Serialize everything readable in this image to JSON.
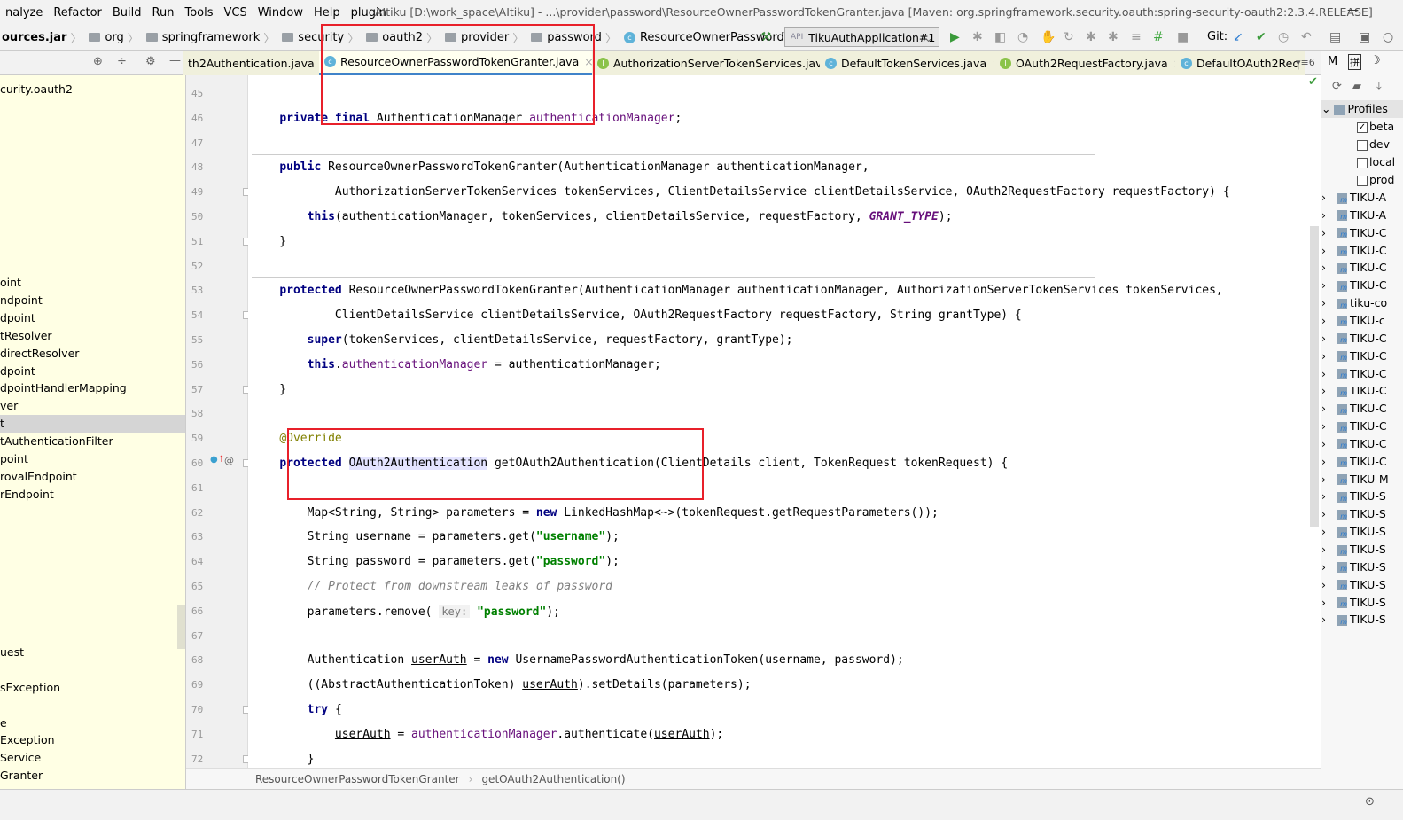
{
  "menu": [
    "nalyze",
    "Refactor",
    "Build",
    "Run",
    "Tools",
    "VCS",
    "Window",
    "Help",
    "plugin"
  ],
  "window_title": "AItiku [D:\\work_space\\AItiku] - ...\\provider\\password\\ResourceOwnerPasswordTokenGranter.java [Maven: org.springframework.security.oauth:spring-security-oauth2:2.3.4.RELEASE]",
  "breadcrumbs": [
    {
      "label": "ources.jar",
      "icon": "none"
    },
    {
      "label": "org",
      "icon": "folder"
    },
    {
      "label": "springframework",
      "icon": "folder"
    },
    {
      "label": "security",
      "icon": "folder"
    },
    {
      "label": "oauth2",
      "icon": "folder"
    },
    {
      "label": "provider",
      "icon": "folder"
    },
    {
      "label": "password",
      "icon": "folder"
    },
    {
      "label": "ResourceOwnerPasswordTokenGranter",
      "icon": "class"
    }
  ],
  "run_config": "TikuAuthApplication#1",
  "git_label": "Git:",
  "tabs": [
    {
      "label": "th2Authentication.java",
      "icon": "none"
    },
    {
      "label": "ResourceOwnerPasswordTokenGranter.java",
      "icon": "class",
      "active": true
    },
    {
      "label": "AuthorizationServerTokenServices.java",
      "icon": "interface"
    },
    {
      "label": "DefaultTokenServices.java",
      "icon": "class"
    },
    {
      "label": "OAuth2RequestFactory.java",
      "icon": "interface"
    },
    {
      "label": "DefaultOAuth2Req",
      "icon": "class"
    }
  ],
  "tab_overflow": "6",
  "left_tree": [
    {
      "row": 0,
      "label": "curity.oauth2"
    },
    {
      "row": 11,
      "label": "oint"
    },
    {
      "row": 12,
      "label": "ndpoint"
    },
    {
      "row": 13,
      "label": "dpoint"
    },
    {
      "row": 14,
      "label": "tResolver"
    },
    {
      "row": 15,
      "label": "directResolver"
    },
    {
      "row": 16,
      "label": "dpoint"
    },
    {
      "row": 17,
      "label": "dpointHandlerMapping"
    },
    {
      "row": 18,
      "label": "ver"
    },
    {
      "row": 19,
      "label": "t",
      "selected": true
    },
    {
      "row": 20,
      "label": "tAuthenticationFilter"
    },
    {
      "row": 21,
      "label": "point"
    },
    {
      "row": 22,
      "label": "rovalEndpoint"
    },
    {
      "row": 23,
      "label": "rEndpoint"
    },
    {
      "row": 32,
      "label": "uest"
    },
    {
      "row": 34,
      "label": "sException"
    },
    {
      "row": 36,
      "label": "e"
    },
    {
      "row": 37,
      "label": "Exception"
    },
    {
      "row": 38,
      "label": "Service"
    },
    {
      "row": 39,
      "label": "Granter"
    }
  ],
  "code_lines": [
    {
      "n": "45",
      "t": []
    },
    {
      "n": "46",
      "t": [
        [
          "    ",
          ""
        ],
        [
          "private final ",
          "kw"
        ],
        [
          "AuthenticationManager ",
          ""
        ],
        [
          "authenticationManager",
          "fld"
        ],
        [
          ";",
          ""
        ]
      ]
    },
    {
      "n": "47",
      "t": []
    },
    {
      "n": "48",
      "t": [
        [
          "    ",
          ""
        ],
        [
          "public ",
          "kw"
        ],
        [
          "ResourceOwnerPasswordTokenGranter(AuthenticationManager authenticationManager,",
          ""
        ]
      ]
    },
    {
      "n": "49",
      "t": [
        [
          "            AuthorizationServerTokenServices tokenServices, ClientDetailsService clientDetailsService, OAuth2RequestFactory requestFactory) {",
          ""
        ]
      ]
    },
    {
      "n": "50",
      "t": [
        [
          "        ",
          ""
        ],
        [
          "this",
          "kw"
        ],
        [
          "(authenticationManager, tokenServices, clientDetailsService, requestFactory, ",
          ""
        ],
        [
          "GRANT_TYPE",
          "cst"
        ],
        [
          ");",
          ""
        ]
      ]
    },
    {
      "n": "51",
      "t": [
        [
          "    }",
          ""
        ]
      ]
    },
    {
      "n": "52",
      "t": []
    },
    {
      "n": "53",
      "t": [
        [
          "    ",
          ""
        ],
        [
          "protected ",
          "kw"
        ],
        [
          "ResourceOwnerPasswordTokenGranter(AuthenticationManager authenticationManager, AuthorizationServerTokenServices tokenServices,",
          ""
        ]
      ]
    },
    {
      "n": "54",
      "t": [
        [
          "            ClientDetailsService clientDetailsService, OAuth2RequestFactory requestFactory, String grantType) {",
          ""
        ]
      ]
    },
    {
      "n": "55",
      "t": [
        [
          "        ",
          ""
        ],
        [
          "super",
          "kw"
        ],
        [
          "(tokenServices, clientDetailsService, requestFactory, grantType);",
          ""
        ]
      ]
    },
    {
      "n": "56",
      "t": [
        [
          "        ",
          ""
        ],
        [
          "this",
          "kw"
        ],
        [
          ".",
          ""
        ],
        [
          "authenticationManager",
          "fld"
        ],
        [
          " = authenticationManager;",
          ""
        ]
      ]
    },
    {
      "n": "57",
      "t": [
        [
          "    }",
          ""
        ]
      ]
    },
    {
      "n": "58",
      "t": []
    },
    {
      "n": "59",
      "t": [
        [
          "    ",
          ""
        ],
        [
          "@Override",
          "ann"
        ]
      ]
    },
    {
      "n": "60",
      "t": [
        [
          "    ",
          ""
        ],
        [
          "protected ",
          "kw"
        ],
        [
          "OAuth2Authentication",
          "hl"
        ],
        [
          " getOAuth2Authentication(ClientDetails client, TokenRequest tokenRequest) {",
          ""
        ]
      ]
    },
    {
      "n": "61",
      "t": []
    },
    {
      "n": "62",
      "t": [
        [
          "        Map<String, String> parameters = ",
          ""
        ],
        [
          "new ",
          "kw"
        ],
        [
          "LinkedHashMap<~>(tokenRequest.getRequestParameters());",
          ""
        ]
      ]
    },
    {
      "n": "63",
      "t": [
        [
          "        String username = parameters.get(",
          ""
        ],
        [
          "\"username\"",
          "str"
        ],
        [
          ");",
          ""
        ]
      ]
    },
    {
      "n": "64",
      "t": [
        [
          "        String password = parameters.get(",
          ""
        ],
        [
          "\"password\"",
          "str"
        ],
        [
          ");",
          ""
        ]
      ]
    },
    {
      "n": "65",
      "t": [
        [
          "        ",
          ""
        ],
        [
          "// Protect from downstream leaks of password",
          "cm"
        ]
      ]
    },
    {
      "n": "66",
      "t": [
        [
          "        parameters.remove( ",
          ""
        ],
        [
          "key:",
          "hint"
        ],
        [
          " ",
          ""
        ],
        [
          "\"password\"",
          "str"
        ],
        [
          ");",
          ""
        ]
      ]
    },
    {
      "n": "67",
      "t": []
    },
    {
      "n": "68",
      "t": [
        [
          "        Authentication ",
          ""
        ],
        [
          "userAuth",
          "und"
        ],
        [
          " = ",
          ""
        ],
        [
          "new ",
          "kw"
        ],
        [
          "UsernamePasswordAuthenticationToken(username, password);",
          ""
        ]
      ]
    },
    {
      "n": "69",
      "t": [
        [
          "        ((AbstractAuthenticationToken) ",
          ""
        ],
        [
          "userAuth",
          "und"
        ],
        [
          ").setDetails(parameters);",
          ""
        ]
      ]
    },
    {
      "n": "70",
      "t": [
        [
          "        ",
          ""
        ],
        [
          "try ",
          "kw"
        ],
        [
          "{",
          ""
        ]
      ]
    },
    {
      "n": "71",
      "t": [
        [
          "            ",
          ""
        ],
        [
          "userAuth",
          "und"
        ],
        [
          " = ",
          ""
        ],
        [
          "authenticationManager",
          "fld"
        ],
        [
          ".authenticate(",
          ""
        ],
        [
          "userAuth",
          "und"
        ],
        [
          ");",
          ""
        ]
      ]
    },
    {
      "n": "72",
      "t": [
        [
          "        }",
          ""
        ]
      ]
    }
  ],
  "editor_breadcrumb": [
    "ResourceOwnerPasswordTokenGranter",
    "getOAuth2Authentication()"
  ],
  "maven": {
    "toolbar_label": "M",
    "profiles_label": "Profiles",
    "profiles": [
      {
        "label": "beta",
        "checked": true
      },
      {
        "label": "dev",
        "checked": false
      },
      {
        "label": "local",
        "checked": false
      },
      {
        "label": "prod",
        "checked": false
      }
    ],
    "modules": [
      "TIKU-A",
      "TIKU-A",
      "TIKU-C",
      "TIKU-C",
      "TIKU-C",
      "TIKU-C",
      "tiku-co",
      "TIKU-c",
      "TIKU-C",
      "TIKU-C",
      "TIKU-C",
      "TIKU-C",
      "TIKU-C",
      "TIKU-C",
      "TIKU-C",
      "TIKU-C",
      "TIKU-M",
      "TIKU-S",
      "TIKU-S",
      "TIKU-S",
      "TIKU-S",
      "TIKU-S",
      "TIKU-S",
      "TIKU-S",
      "TIKU-S"
    ]
  },
  "colors": {
    "annotation_red": "#e8202a",
    "tab_accent": "#4083c9",
    "keyword": "#000080",
    "string": "#008000",
    "field": "#660e7a"
  }
}
